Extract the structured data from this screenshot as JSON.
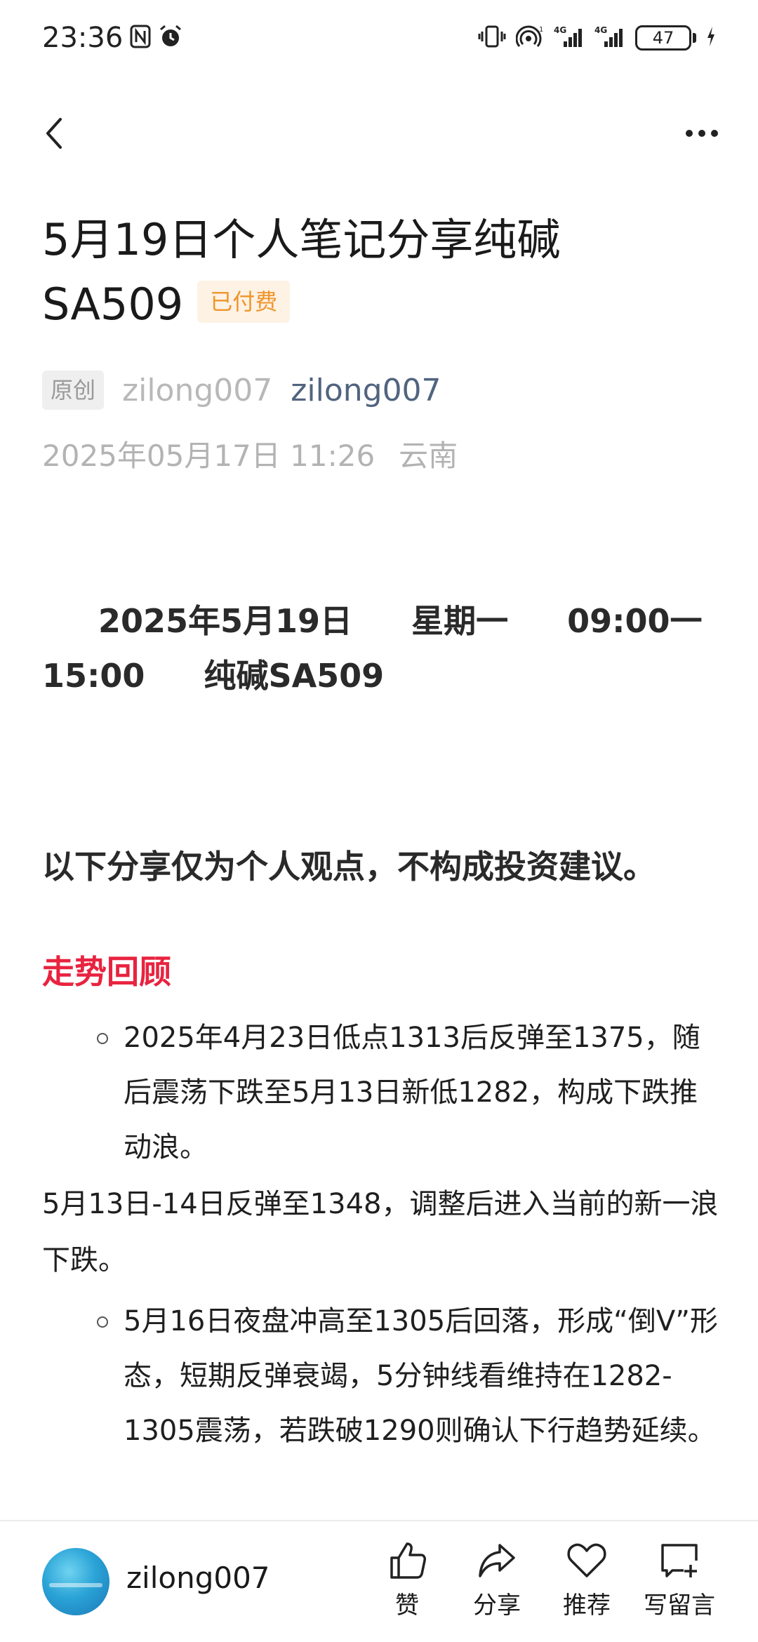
{
  "status_bar": {
    "time": "23:36",
    "battery": "47",
    "network_1": "4G",
    "network_2": "4G"
  },
  "article": {
    "title": "5月19日个人笔记分享纯碱SA509",
    "paid_badge": "已付费",
    "original_badge": "原创",
    "author_plain": "zilong007",
    "author_link": "zilong007",
    "date": "2025年05月17日 11:26",
    "location": "云南",
    "heading": {
      "date": "2025年5月19日",
      "weekday": "星期一",
      "time_start": "09:00一",
      "time_end": "15:00",
      "product": "纯碱SA509"
    },
    "disclaimer": "以下分享仅为个人观点，不构成投资建议。",
    "section_title": "走势回顾",
    "bullet_1": "2025年4月23日低点1313后反弹至1375，随后震荡下跌至5月13日新低1282，构成下跌推动浪。",
    "paragraph_1": "5月13日-14日反弹至1348，调整后进入当前的新一浪下跌。",
    "bullet_2": "5月16日夜盘冲高至1305后回落，形成“倒V”形态，短期反弹衰竭，5分钟线看维持在1282-1305震荡，若跌破1290则确认下行趋势延续。"
  },
  "bottom_bar": {
    "username": "zilong007",
    "like_label": "赞",
    "share_label": "分享",
    "recommend_label": "推荐",
    "comment_label": "写留言"
  },
  "colors": {
    "accent_red": "#e8233f",
    "link_blue": "#51647f",
    "paid_orange": "#f0942a"
  }
}
